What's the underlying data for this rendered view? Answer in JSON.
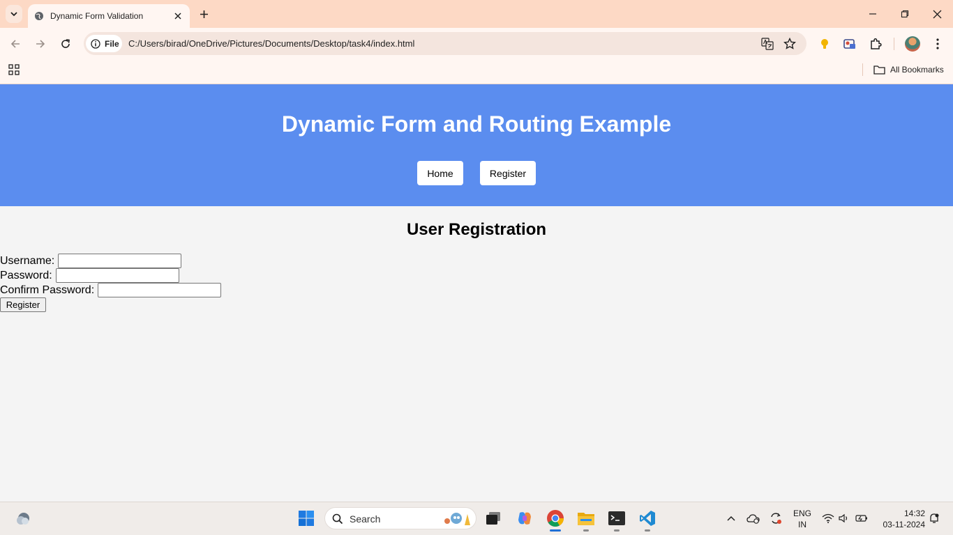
{
  "browser": {
    "tab_title": "Dynamic Form Validation",
    "site_chip_label": "File",
    "url": "C:/Users/birad/OneDrive/Pictures/Documents/Desktop/task4/index.html",
    "bookmarks_label": "All Bookmarks"
  },
  "page": {
    "header_title": "Dynamic Form and Routing Example",
    "nav": [
      {
        "label": "Home"
      },
      {
        "label": "Register"
      }
    ],
    "section_title": "User Registration",
    "form": {
      "username_label": "Username:",
      "username_value": "",
      "password_label": "Password:",
      "password_value": "",
      "confirm_label": "Confirm Password:",
      "confirm_value": "",
      "submit_label": "Register"
    }
  },
  "taskbar": {
    "search_placeholder": "Search",
    "language": "ENG",
    "region": "IN",
    "time": "14:32",
    "date": "03-11-2024"
  },
  "colors": {
    "header_bg": "#5b8def",
    "tabstrip_bg": "#fdd9c5",
    "page_bg": "#f4f4f4"
  }
}
